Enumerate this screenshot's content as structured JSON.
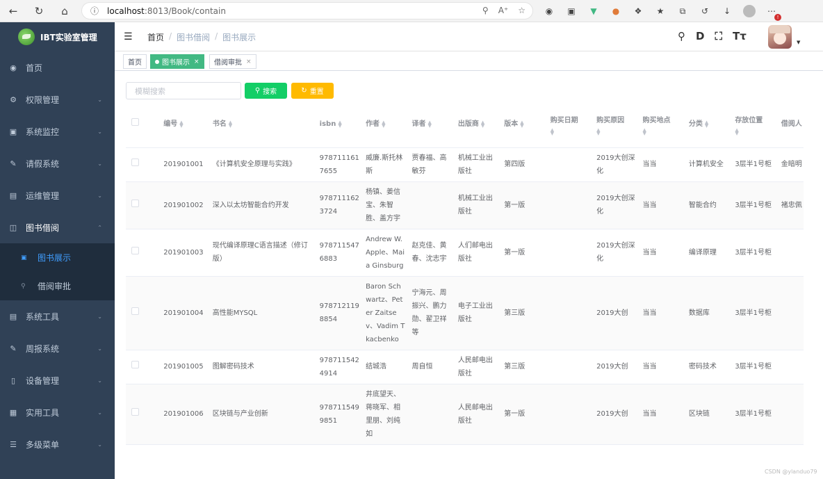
{
  "browser": {
    "host": "localhost",
    "path": ":8013/Book/contain"
  },
  "sidebar": {
    "title": "IBT实验室管理",
    "items": [
      {
        "label": "首页",
        "icon": "dashboard-icon"
      },
      {
        "label": "权限管理",
        "icon": "gear-icon"
      },
      {
        "label": "系统监控",
        "icon": "monitor-icon"
      },
      {
        "label": "请假系统",
        "icon": "edit-icon"
      },
      {
        "label": "运维管理",
        "icon": "server-icon"
      },
      {
        "label": "图书借阅",
        "icon": "book-icon"
      },
      {
        "label": "系统工具",
        "icon": "toolbox-icon"
      },
      {
        "label": "周报系统",
        "icon": "edit-icon"
      },
      {
        "label": "设备管理",
        "icon": "device-icon"
      },
      {
        "label": "实用工具",
        "icon": "grid-icon"
      },
      {
        "label": "多级菜单",
        "icon": "list-icon"
      }
    ],
    "submenu": [
      {
        "label": "图书展示",
        "icon": "image-icon"
      },
      {
        "label": "借阅审批",
        "icon": "lock-icon"
      }
    ]
  },
  "header": {
    "breadcrumb": [
      "首页",
      "图书借阅",
      "图书展示"
    ]
  },
  "tags": [
    {
      "label": "首页"
    },
    {
      "label": "图书展示",
      "close": "×"
    },
    {
      "label": "借阅审批",
      "close": "×"
    }
  ],
  "toolbar": {
    "search_placeholder": "模糊搜索",
    "search_label": "搜索",
    "reset_label": "重置"
  },
  "table": {
    "columns": [
      "编号",
      "书名",
      "isbn",
      "作者",
      "译者",
      "出版商",
      "版本",
      "购买日期",
      "购买原因",
      "购买地点",
      "分类",
      "存放位置",
      "借阅人"
    ],
    "rows": [
      [
        "201901001",
        "《计算机安全原理与实践》",
        "9787111617655",
        "威廉.斯托林斯",
        "贾春福、高敏芬",
        "机械工业出版社",
        "第四版",
        "",
        "2019大创深化",
        "当当",
        "计算机安全",
        "3层半1号柜",
        "金暗明"
      ],
      [
        "201901002",
        "深入以太坊智能合约开发",
        "9787111623724",
        "杨镇、姜信宝、朱智胜、盖方宇",
        "",
        "机械工业出版社",
        "第一版",
        "",
        "2019大创深化",
        "当当",
        "智能合约",
        "3层半1号柜",
        "褚忠佩"
      ],
      [
        "201901003",
        "现代编译原理C语言描述（修订版）",
        "9787115476883",
        "Andrew W. Apple、Maia Ginsburg",
        "赵克佳、黄春、沈志宇",
        "人们邮电出版社",
        "第一版",
        "",
        "2019大创深化",
        "当当",
        "编译原理",
        "3层半1号柜",
        ""
      ],
      [
        "201901004",
        "高性能MYSQL",
        "9787121198854",
        "Baron Schwartz、Peter Zaitsev、Vadim Tkacbenko",
        "宁海元、周振兴、鹏力勋、翟卫祥等",
        "电子工业出版社",
        "第三版",
        "",
        "2019大创",
        "当当",
        "数据库",
        "3层半1号柜",
        ""
      ],
      [
        "201901005",
        "图解密码技术",
        "9787115424914",
        "结城浩",
        "周自恒",
        "人民邮电出版社",
        "第三版",
        "",
        "2019大创",
        "当当",
        "密码技术",
        "3层半1号柜",
        ""
      ],
      [
        "201901006",
        "区块链与产业创新",
        "9787115499851",
        "井底望天、蒋晓军、相里朋、刘纯如",
        "",
        "人民邮电出版社",
        "第一版",
        "",
        "2019大创",
        "当当",
        "区块链",
        "3层半1号柜",
        ""
      ]
    ]
  },
  "watermark": "CSDN @ylanduo79"
}
